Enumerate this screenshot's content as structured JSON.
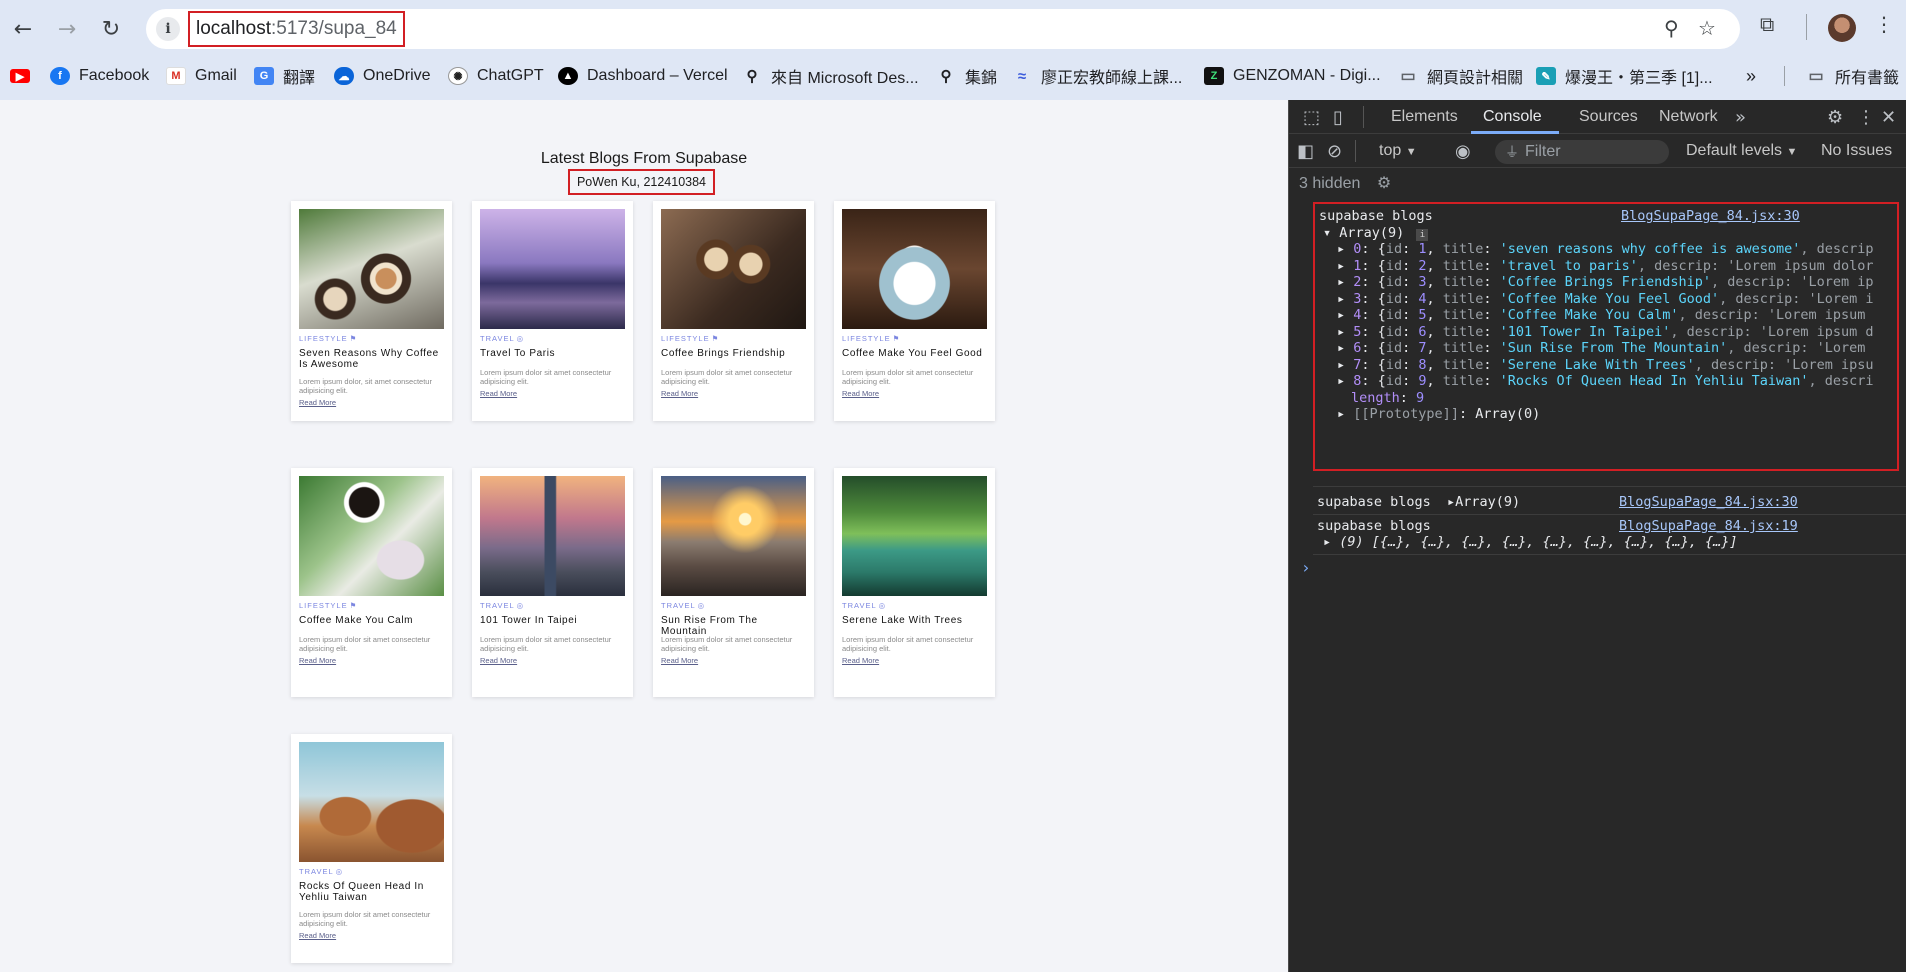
{
  "browser": {
    "url_host": "localhost",
    "url_path": ":5173/supa_84",
    "bookmarks": [
      {
        "label": "",
        "icon": "youtube-icon"
      },
      {
        "label": "Facebook",
        "icon": "facebook-icon"
      },
      {
        "label": "Gmail",
        "icon": "gmail-icon"
      },
      {
        "label": "翻譯",
        "icon": "translate-icon"
      },
      {
        "label": "OneDrive",
        "icon": "onedrive-icon"
      },
      {
        "label": "ChatGPT",
        "icon": "chatgpt-icon"
      },
      {
        "label": "Dashboard – Vercel",
        "icon": "vercel-icon"
      },
      {
        "label": "來自 Microsoft Des...",
        "icon": "search-icon"
      },
      {
        "label": "集錦",
        "icon": "search-icon"
      },
      {
        "label": "廖正宏教師線上課...",
        "icon": "course-icon"
      },
      {
        "label": "GENZOMAN - Digi...",
        "icon": "genzoman-icon"
      },
      {
        "label": "網頁設計相關",
        "icon": "folder-icon"
      },
      {
        "label": "爆漫王・第三季 [1]...",
        "icon": "manga-icon"
      },
      {
        "label": "所有書籤",
        "icon": "folder-icon"
      }
    ]
  },
  "page": {
    "title": "Latest Blogs From Supabase",
    "author": "PoWen Ku, 212410384",
    "cards": [
      {
        "category": "LIFESTYLE",
        "cat_icon": "flag-icon",
        "title": "Seven Reasons Why Coffee Is Awesome",
        "desc": "Lorem ipsum dolor, sit amet consectetur adipisicing elit.",
        "more": "Read More",
        "img": "coffee-latte-plants"
      },
      {
        "category": "TRAVEL",
        "cat_icon": "globe-icon",
        "title": "Travel To Paris",
        "desc": "Lorem ipsum dolor sit amet consectetur adipisicing elit.",
        "more": "Read More",
        "img": "paris-bridge"
      },
      {
        "category": "LIFESTYLE",
        "cat_icon": "flag-icon",
        "title": "Coffee Brings Friendship",
        "desc": "Lorem ipsum dolor sit amet consectetur adipisicing elit.",
        "more": "Read More",
        "img": "coffee-cheers"
      },
      {
        "category": "LIFESTYLE",
        "cat_icon": "flag-icon",
        "title": "Coffee Make You Feel Good",
        "desc": "Lorem ipsum dolor sit amet consectetur adipisicing elit.",
        "more": "Read More",
        "img": "coffee-cup-blue"
      },
      {
        "category": "LIFESTYLE",
        "cat_icon": "flag-icon",
        "title": "Coffee Make You Calm",
        "desc": "Lorem ipsum dolor sit amet consectetur adipisicing elit.",
        "more": "Read More",
        "img": "coffee-leaves"
      },
      {
        "category": "TRAVEL",
        "cat_icon": "globe-icon",
        "title": "101 Tower In Taipei",
        "desc": "Lorem ipsum dolor sit amet consectetur adipisicing elit.",
        "more": "Read More",
        "img": "taipei-101"
      },
      {
        "category": "TRAVEL",
        "cat_icon": "globe-icon",
        "title": "Sun Rise From The Mountain",
        "desc": "Lorem ipsum dolor sit amet consectetur adipisicing elit.",
        "more": "Read More",
        "img": "sunrise-mountain"
      },
      {
        "category": "TRAVEL",
        "cat_icon": "globe-icon",
        "title": "Serene Lake With Trees",
        "desc": "Lorem ipsum dolor sit amet consectetur adipisicing elit.",
        "more": "Read More",
        "img": "lake-trees"
      },
      {
        "category": "TRAVEL",
        "cat_icon": "globe-icon",
        "title": "Rocks Of Queen Head In Yehliu Taiwan",
        "desc": "Lorem ipsum dolor sit amet consectetur adipisicing elit.",
        "more": "Read More",
        "img": "queen-head-rock"
      }
    ]
  },
  "devtools": {
    "tabs": [
      "Elements",
      "Console",
      "Sources",
      "Network"
    ],
    "active_tab": "Console",
    "context": "top",
    "filter_placeholder": "Filter",
    "levels": "Default levels",
    "issues": "No Issues",
    "hidden": "3 hidden",
    "log1": {
      "label": "supabase blogs",
      "source": "BlogSupaPage_84.jsx:30",
      "array_header": "Array(9)",
      "items": [
        {
          "idx": "0",
          "id": "1",
          "title": "'seven reasons why coffee is awesome'",
          "tail": ", descrip"
        },
        {
          "idx": "1",
          "id": "2",
          "title": "'travel to paris'",
          "tail": ", descrip: 'Lorem ipsum dolor"
        },
        {
          "idx": "2",
          "id": "3",
          "title": "'Coffee Brings Friendship'",
          "tail": ", descrip: 'Lorem ip"
        },
        {
          "idx": "3",
          "id": "4",
          "title": "'Coffee Make You Feel Good'",
          "tail": ", descrip: 'Lorem i"
        },
        {
          "idx": "4",
          "id": "5",
          "title": "'Coffee Make You Calm'",
          "tail": ", descrip: 'Lorem ipsum"
        },
        {
          "idx": "5",
          "id": "6",
          "title": "'101 Tower In Taipei'",
          "tail": ", descrip: 'Lorem ipsum d"
        },
        {
          "idx": "6",
          "id": "7",
          "title": "'Sun Rise From The Mountain'",
          "tail": ", descrip: 'Lorem"
        },
        {
          "idx": "7",
          "id": "8",
          "title": "'Serene Lake With Trees'",
          "tail": ", descrip: 'Lorem ipsu"
        },
        {
          "idx": "8",
          "id": "9",
          "title": "'Rocks Of Queen Head In Yehliu Taiwan'",
          "tail": ", descri"
        }
      ],
      "length_label": "length",
      "length_value": "9",
      "prototype_label": "[[Prototype]]",
      "prototype_value": "Array(0)"
    },
    "log2": {
      "label": "supabase blogs",
      "value": "Array(9)",
      "source": "BlogSupaPage_84.jsx:30"
    },
    "log3": {
      "label": "supabase blogs",
      "source": "BlogSupaPage_84.jsx:19",
      "value": "(9) [{…}, {…}, {…}, {…}, {…}, {…}, {…}, {…}, {…}]"
    },
    "prompt": "›"
  },
  "colors": {
    "highlight": "#d21f24",
    "category": "#7b86e0",
    "devtools_bg": "#282828",
    "string": "#5cd5fb",
    "number": "#9d8eff",
    "link": "#a8c7fa"
  }
}
